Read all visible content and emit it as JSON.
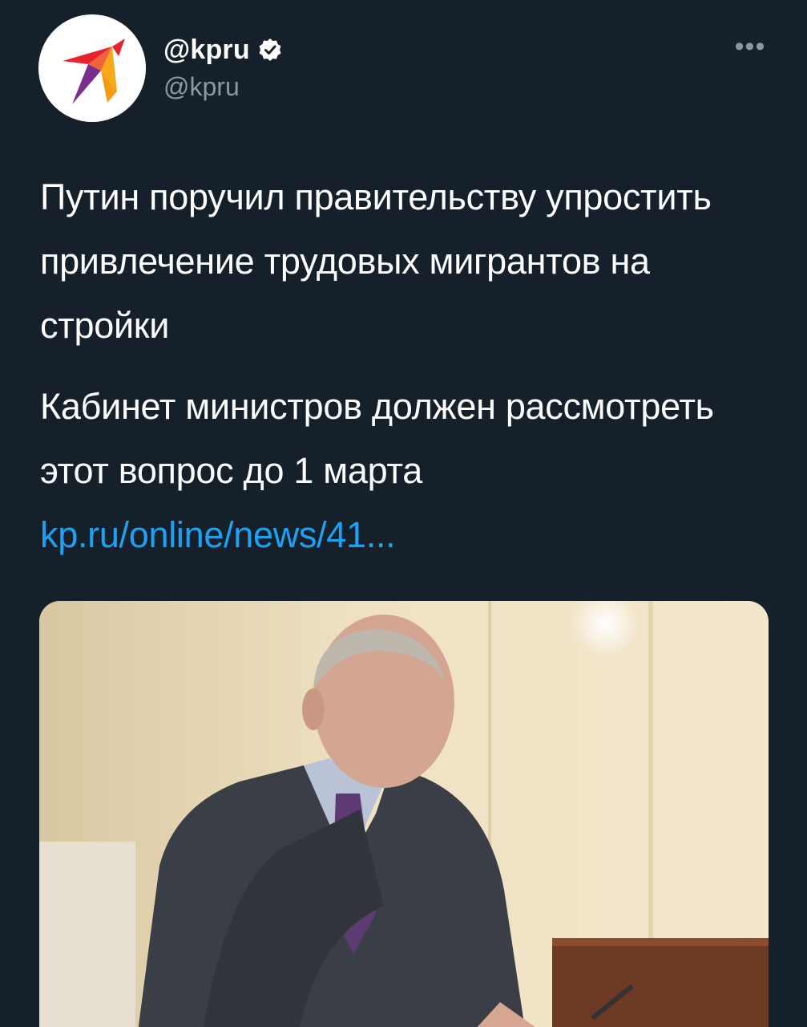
{
  "account": {
    "display_name": "@kpru",
    "handle": "@kpru",
    "avatar_icon": "kp-swallow-logo-icon",
    "verified_icon": "verified-badge-icon",
    "more_icon": "more-horizontal-icon",
    "more_label": "•••"
  },
  "tweet": {
    "paragraph1": "Путин поручил правительству упростить привлечение трудовых мигрантов на стройки",
    "paragraph2_text": "Кабинет министров должен рассмотреть этот вопрос до 1 марта",
    "link_text": "kp.ru/online/news/41..."
  },
  "media": {
    "description_icon": "photo-man-at-desk-image"
  },
  "colors": {
    "background": "#15202b",
    "text": "#ffffff",
    "secondary": "#8899a6",
    "link": "#1da1f2"
  }
}
